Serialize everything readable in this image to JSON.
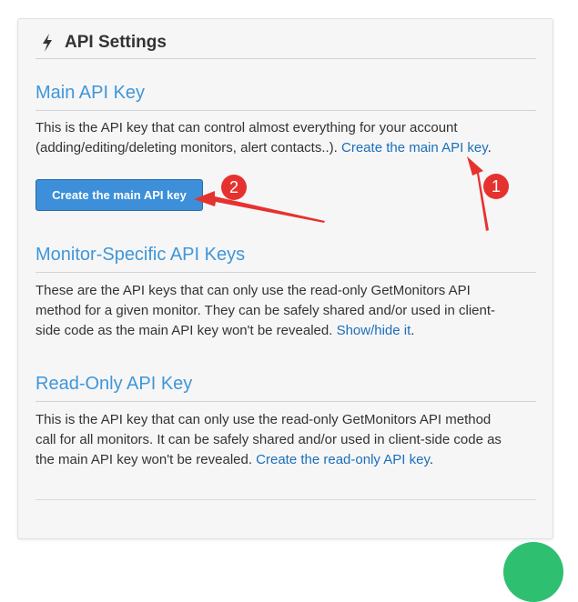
{
  "panel": {
    "title": "API Settings",
    "icon": "bolt-icon"
  },
  "main_key": {
    "title": "Main API Key",
    "text_line1": "This is the API key that can control almost everything for your account",
    "text_line2": "(adding/editing/deleting monitors, alert contacts..). ",
    "link": "Create the main API key",
    "link_suffix": ".",
    "button_label": "Create the main API key"
  },
  "monitor_keys": {
    "title": "Monitor-Specific API Keys",
    "text_line1": "These are the API keys that can only use the read-only GetMonitors API",
    "text_line2": "method for a given monitor. They can be safely shared and/or used in client-",
    "text_line3": "side code as the main API key won't be revealed. ",
    "link": "Show/hide it",
    "link_suffix": "."
  },
  "readonly_key": {
    "title": "Read-Only API Key",
    "text_line1": "This is the API key that can only use the read-only GetMonitors API method",
    "text_line2": "call for all monitors. It can be safely shared and/or used in client-side code as",
    "text_line3": "the main API key won't be revealed. ",
    "link": "Create the read-only API key",
    "link_suffix": "."
  },
  "annotations": {
    "badge1": "1",
    "badge2": "2",
    "color": "#e6322f"
  },
  "colors": {
    "section_title": "#3f96d8",
    "link": "#1b6fb9",
    "button": "#3c8fd8",
    "fab": "#2fbf71"
  }
}
